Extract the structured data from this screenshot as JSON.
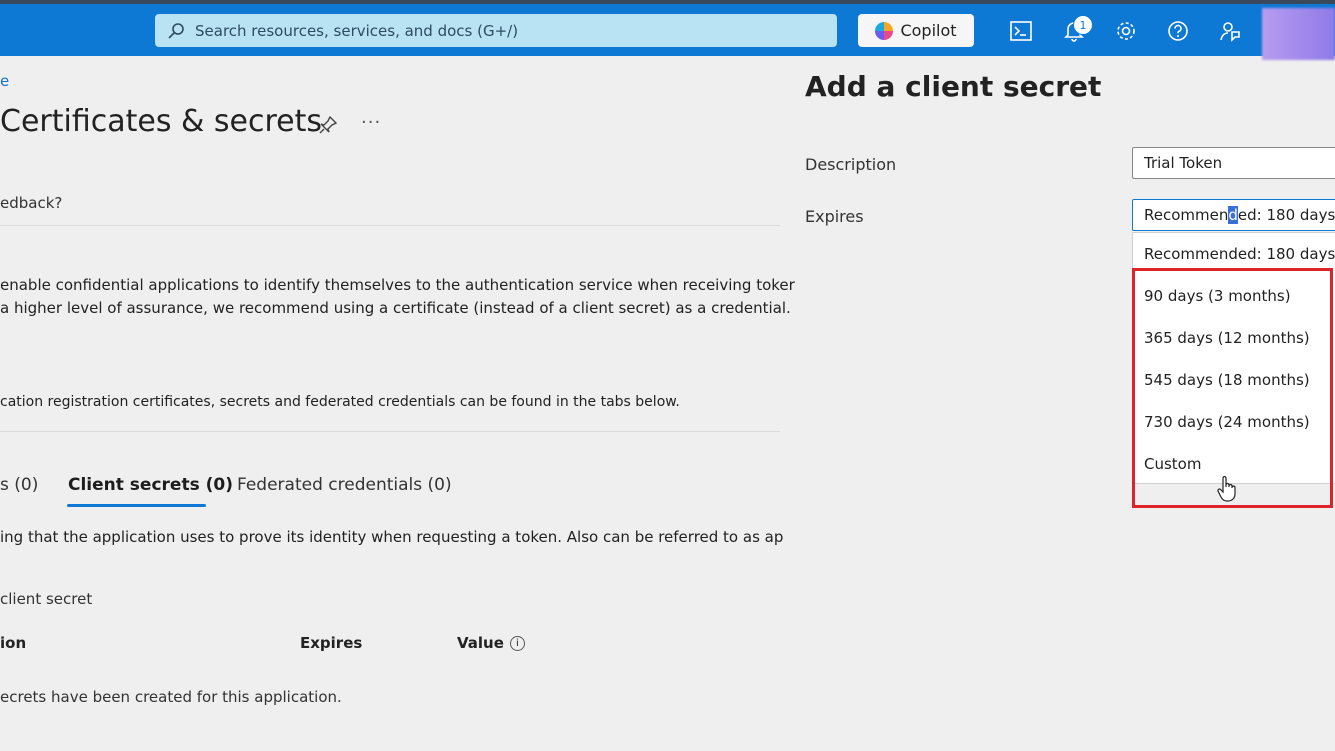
{
  "topbar": {
    "search_placeholder": "Search resources, services, and docs (G+/)",
    "copilot_label": "Copilot",
    "notification_count": "1",
    "accent": "#0e78d5"
  },
  "page": {
    "breadcrumb": "e",
    "title": "Certificates & secrets",
    "more": "···",
    "feedback": "edback?",
    "intro_line1": "enable confidential applications to identify themselves to the authentication service when receiving toker",
    "intro_line2": " a higher level of assurance, we recommend using a certificate (instead of a client secret) as a credential.",
    "tabs_note": "cation registration certificates, secrets and federated credentials can be found in the tabs below.",
    "tabs": [
      {
        "label": "s (0)"
      },
      {
        "label": "Client secrets (0)"
      },
      {
        "label": "Federated credentials (0)"
      }
    ],
    "secret_desc": "ing that the application uses to prove its identity when requesting a token. Also can be referred to as ap",
    "new_secret": "client secret",
    "columns": {
      "description": "ion",
      "expires": "Expires",
      "value": "Value"
    },
    "empty_message": "ecrets have been created for this application."
  },
  "pane": {
    "title": "Add a client secret",
    "description_label": "Description",
    "description_value": "Trial Token",
    "expires_label": "Expires",
    "expires_value_pre": "Recommen",
    "expires_value_mark": "d",
    "expires_value_post": "ed: 180 days",
    "options": [
      "Recommended: 180 days",
      "90 days (3 months)",
      "365 days (12 months)",
      "545 days (18 months)",
      "730 days (24 months)",
      "Custom"
    ],
    "highlight_color": "#e0232b"
  }
}
